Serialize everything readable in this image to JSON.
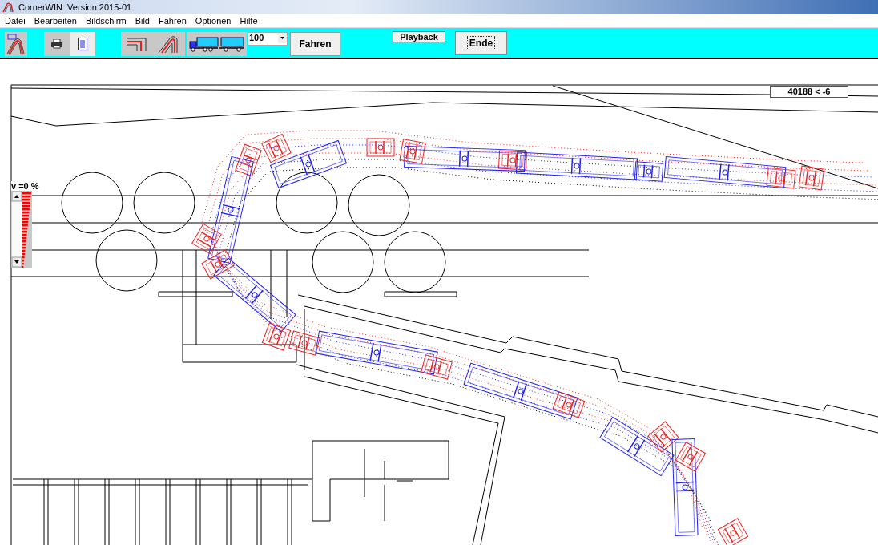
{
  "window": {
    "title": "CornerWIN  Version 2015-01"
  },
  "menu": [
    "Datei",
    "Bearbeiten",
    "Bildschirm",
    "Bild",
    "Fahren",
    "Optionen",
    "Hilfe"
  ],
  "toolbar": {
    "zoom_select": {
      "value": "100"
    },
    "drive_button": "Fahren",
    "playback_button": "Playback",
    "end_button": {
      "label": "Ende",
      "focused": true
    }
  },
  "canvas": {
    "speed_reading": "v =0 %",
    "position_readout": "40188 < -6"
  }
}
